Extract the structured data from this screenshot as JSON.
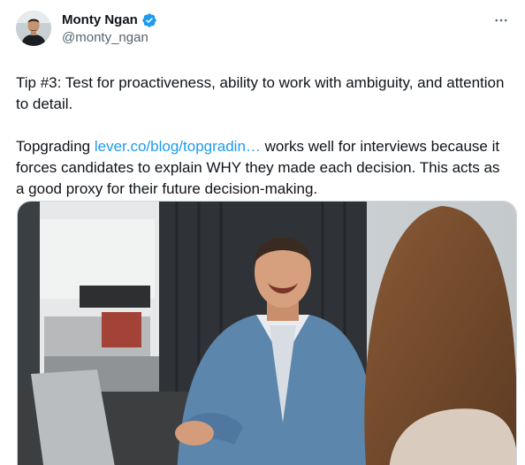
{
  "author": {
    "display_name": "Monty Ngan",
    "handle": "@monty_ngan",
    "verified": true,
    "avatar_icon": "avatar-photo",
    "verified_icon": "verified-badge-icon",
    "verified_color": "#1d9bf0"
  },
  "menu": {
    "icon": "more-icon",
    "label": "···"
  },
  "body": {
    "paragraph1": "Tip #3: Test for proactiveness, ability to work with ambiguity, and attention to detail.",
    "paragraph2_before": "Topgrading ",
    "paragraph2_link": "lever.co/blog/topgradin…",
    "paragraph2_after": " works well for interviews because it forces candidates to explain WHY they made each decision. This acts as a good proxy for their future decision-making."
  },
  "colors": {
    "text": "#0f1419",
    "secondary": "#536471",
    "link": "#1d9bf0",
    "border": "#cfd9de"
  },
  "media": {
    "type": "photo"
  }
}
